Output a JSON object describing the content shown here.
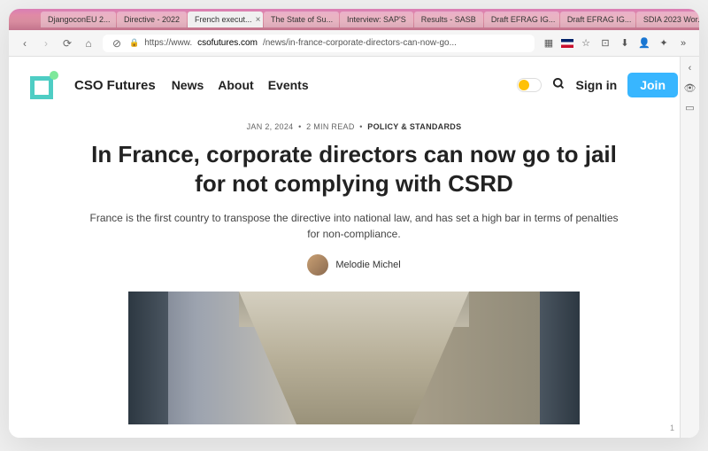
{
  "titlebar": {
    "tabs": [
      {
        "label": "DjangoconEU 2..."
      },
      {
        "label": "Directive - 2022"
      },
      {
        "label": "French execut..."
      },
      {
        "label": "The State of Su..."
      },
      {
        "label": "Interview: SAP'S"
      },
      {
        "label": "Results - SASB"
      },
      {
        "label": "Draft EFRAG IG..."
      },
      {
        "label": "Draft EFRAG IG..."
      },
      {
        "label": "SDIA 2023 Wor..."
      }
    ],
    "active_index": 2
  },
  "addressbar": {
    "prefix": "https://www.",
    "domain": "csofutures.com",
    "path": "/news/in-france-corporate-directors-can-now-go..."
  },
  "site": {
    "brand": "CSO Futures",
    "nav": [
      "News",
      "About",
      "Events"
    ],
    "signin": "Sign in",
    "join": "Join"
  },
  "article": {
    "date": "JAN 2, 2024",
    "readtime": "2 MIN READ",
    "category": "POLICY & STANDARDS",
    "title": "In France, corporate directors can now go to jail for not complying with CSRD",
    "subtitle": "France is the first country to transpose the directive into national law, and has set a high bar in terms of penalties for non-compliance.",
    "author": "Melodie Michel"
  },
  "page_number": "1"
}
